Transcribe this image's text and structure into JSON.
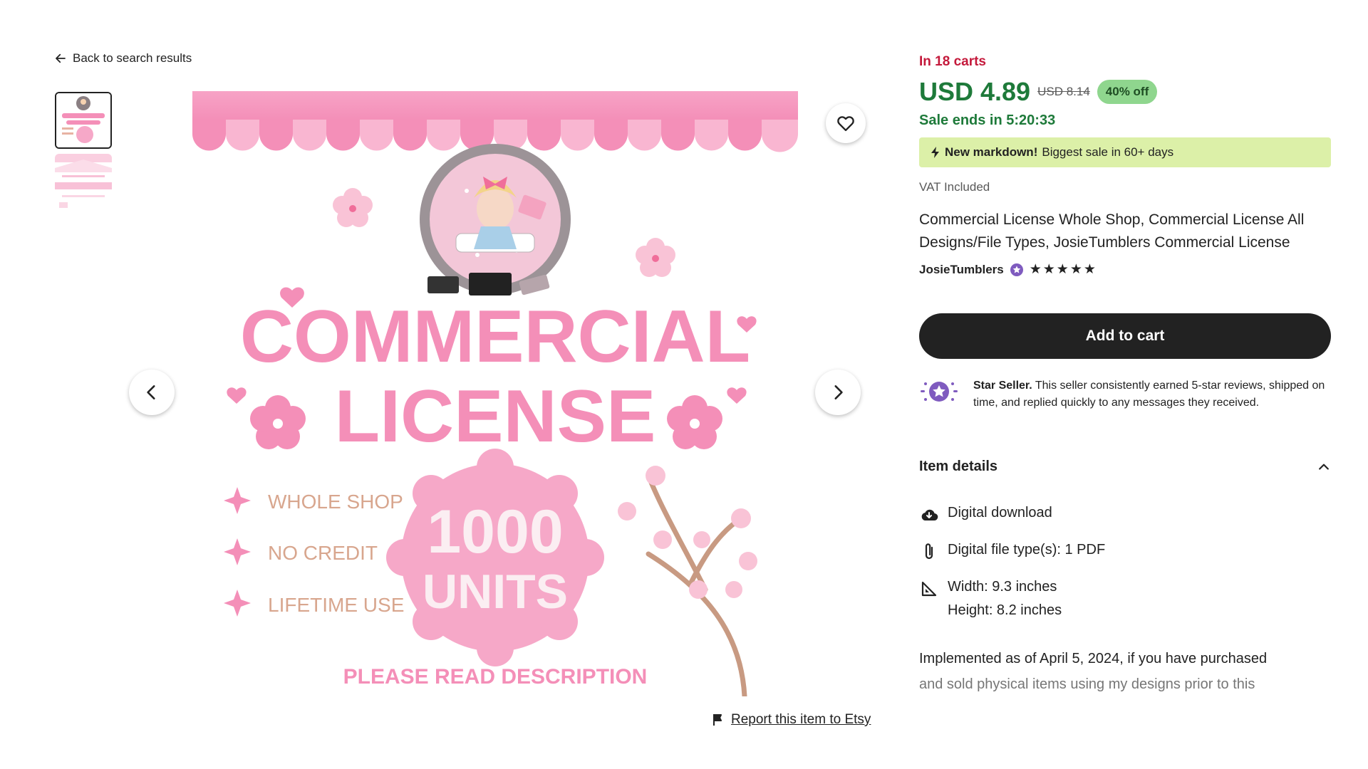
{
  "nav": {
    "back_label": "Back to search results"
  },
  "gallery": {
    "thumb_1_alt": "Commercial License listing image 1",
    "thumb_2_alt": "Commercial License listing image 2",
    "report_label": "Report this item to Etsy"
  },
  "listing_image": {
    "headline_1": "COMMERCIAL",
    "headline_2": "LICENSE",
    "bullets": [
      "WHOLE SHOP",
      "NO CREDIT",
      "LIFETIME USE"
    ],
    "badge_1": "1000",
    "badge_2": "UNITS",
    "footer": "PLEASE READ DESCRIPTION"
  },
  "product": {
    "in_carts": "In 18 carts",
    "price": "USD 4.89",
    "old_price": "USD 8.14",
    "discount": "40% off",
    "sale_ends": "Sale ends in 5:20:33",
    "markdown_bold": "New markdown!",
    "markdown_text": "Biggest sale in 60+ days",
    "vat": "VAT Included",
    "title": "Commercial License Whole Shop, Commercial License All Designs/File Types, JosieTumblers Commercial License",
    "shop_name": "JosieTumblers",
    "stars": "★★★★★",
    "rating_value": 5,
    "add_to_cart": "Add to cart",
    "star_seller_bold": "Star Seller.",
    "star_seller_text": "This seller consistently earned 5-star reviews, shipped on time, and replied quickly to any messages they received."
  },
  "item_details": {
    "heading": "Item details",
    "download": "Digital download",
    "file_type": "Digital file type(s): 1 PDF",
    "width": "Width: 9.3 inches",
    "height": "Height: 8.2 inches",
    "description_line_1": "Implemented as of April 5, 2024, if you have purchased",
    "description_line_2": "and sold physical items using my designs prior to this"
  },
  "colors": {
    "accent_green": "#1e7a3a",
    "alert_red": "#c4193b",
    "brand_pink": "#f48fb8",
    "badge_green": "#8fd68e",
    "markdown_bg": "#dcf0a8",
    "button_dark": "#222222"
  }
}
